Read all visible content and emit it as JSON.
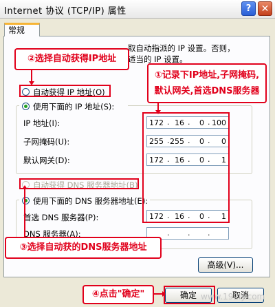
{
  "window": {
    "title": "Internet 协议 (TCP/IP) 属性",
    "help_glyph": "?",
    "close_glyph": "✕"
  },
  "tab": {
    "label": "常规"
  },
  "intro": {
    "line1": "取自动指派的 IP 设置。否则，",
    "line2": "适当的 IP 设置。"
  },
  "ip_section": {
    "auto_label": "自动获得 IP 地址(O)",
    "manual_label": "使用下面的 IP 地址(S):",
    "selected": "manual",
    "fields": [
      {
        "label": "IP 地址(I):",
        "octets": [
          "172",
          "16",
          "0",
          "100"
        ]
      },
      {
        "label": "子网掩码(U):",
        "octets": [
          "255",
          "255",
          "0",
          "0"
        ]
      },
      {
        "label": "默认网关(D):",
        "octets": [
          "172",
          "16",
          "0",
          "1"
        ]
      }
    ]
  },
  "dns_section": {
    "auto_label": "自动获得 DNS 服务器地址(B)",
    "manual_label": "使用下面的 DNS 服务器地址(E):",
    "selected": "manual",
    "fields": [
      {
        "label": "首选 DNS 服务器(P):",
        "octets": [
          "172",
          "16",
          "0",
          "1"
        ]
      },
      {
        "label": "DNS 服务器(A):",
        "octets": [
          "",
          "",
          "",
          ""
        ]
      }
    ]
  },
  "buttons": {
    "advanced": "高级(V)...",
    "ok": "确定",
    "cancel": "取消"
  },
  "annotations": {
    "step1": "①记录下IP地址,子网掩码,默认网关,首选DNS服务器",
    "step1_line1": "①记录下IP地址,子网掩码,",
    "step1_line2": "默认网关,首选DNS服务器",
    "step2": "②选择自动获得IP地址",
    "step3": "③选择自动获的DNS服务器地址",
    "step4": "④点击\"确定\""
  },
  "watermark": "www.192ly.com",
  "colors": {
    "annotation_red": "#e1001b",
    "tab_accent": "#f6b435",
    "radio_selected": "#21a121"
  }
}
